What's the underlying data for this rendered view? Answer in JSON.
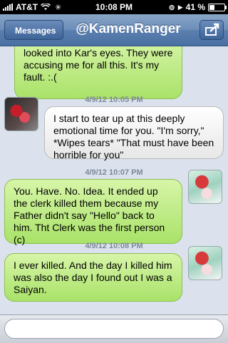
{
  "status_bar": {
    "carrier": "AT&T",
    "time": "10:08 PM",
    "battery": "41 %",
    "battery_level": 0.41
  },
  "nav": {
    "back_label": "Messages",
    "title": "@KamenRanger",
    "action_icon": "share-icon"
  },
  "messages": [
    {
      "text": "looked into Kar's eyes. They were accusing me for all this. It's my fault. :.("
    },
    {
      "timestamp": "4/9/12 10:05 PM",
      "text": "I start to tear up at this deeply emotional time for you. \"I'm sorry,\" *Wipes tears* \"That must have been horrible for you\""
    },
    {
      "timestamp": "4/9/12 10:07 PM",
      "text": "You. Have. No. Idea. It ended up the clerk killed them because my Father didn't say \"Hello\" back to him. Tht Clerk was the first person (c)"
    },
    {
      "timestamp": "4/9/12 10:08 PM",
      "text": "I ever killed. And the day I killed him was also the day I found out I was a Saiyan."
    }
  ],
  "composer": {
    "placeholder": ""
  }
}
